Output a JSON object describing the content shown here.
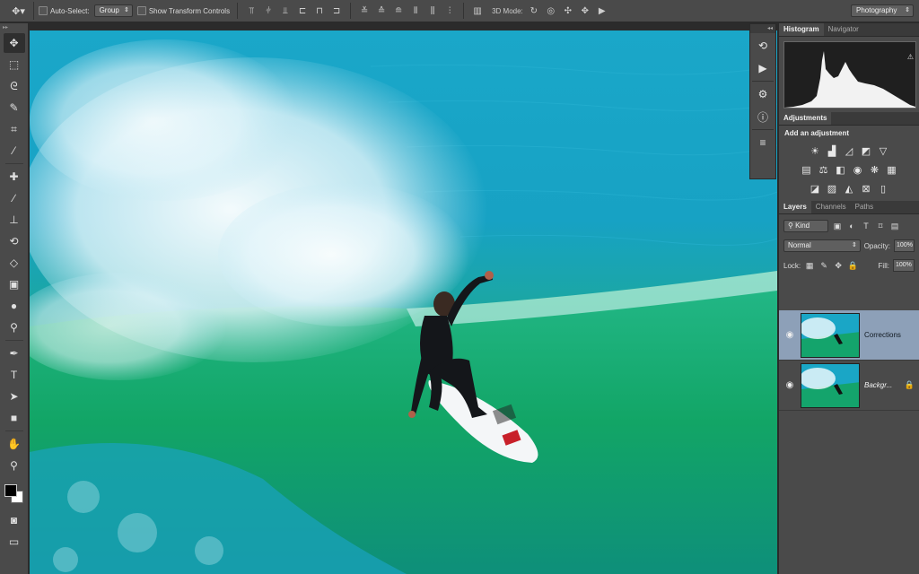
{
  "options_bar": {
    "tool_icon": "move-tool-icon",
    "auto_select_label": "Auto-Select:",
    "auto_select_value": "Group",
    "show_transform_label": "Show Transform Controls",
    "mode_3d_label": "3D Mode:",
    "workspace": "Photography"
  },
  "tools": [
    "move-tool-icon",
    "marquee-tool-icon",
    "lasso-tool-icon",
    "quick-select-tool-icon",
    "crop-tool-icon",
    "eyedropper-tool-icon",
    "healing-brush-tool-icon",
    "brush-tool-icon",
    "clone-stamp-tool-icon",
    "history-brush-tool-icon",
    "eraser-tool-icon",
    "gradient-tool-icon",
    "blur-tool-icon",
    "dodge-tool-icon",
    "pen-tool-icon",
    "type-tool-icon",
    "path-select-tool-icon",
    "rectangle-tool-icon",
    "hand-tool-icon",
    "zoom-tool-icon"
  ],
  "panels": {
    "histogram_tab": "Histogram",
    "navigator_tab": "Navigator",
    "adjustments_tab": "Adjustments",
    "add_adjustment": "Add an adjustment",
    "layers_tab": "Layers",
    "channels_tab": "Channels",
    "paths_tab": "Paths",
    "kind_filter": "Kind",
    "blend_mode": "Normal",
    "opacity_label": "Opacity:",
    "opacity_value": "100%",
    "lock_label": "Lock:",
    "fill_label": "Fill:",
    "fill_value": "100%"
  },
  "layers": [
    {
      "name": "Corrections",
      "selected": true,
      "visible": true,
      "locked": false
    },
    {
      "name": "Backgr...",
      "selected": false,
      "visible": true,
      "locked": true
    }
  ]
}
